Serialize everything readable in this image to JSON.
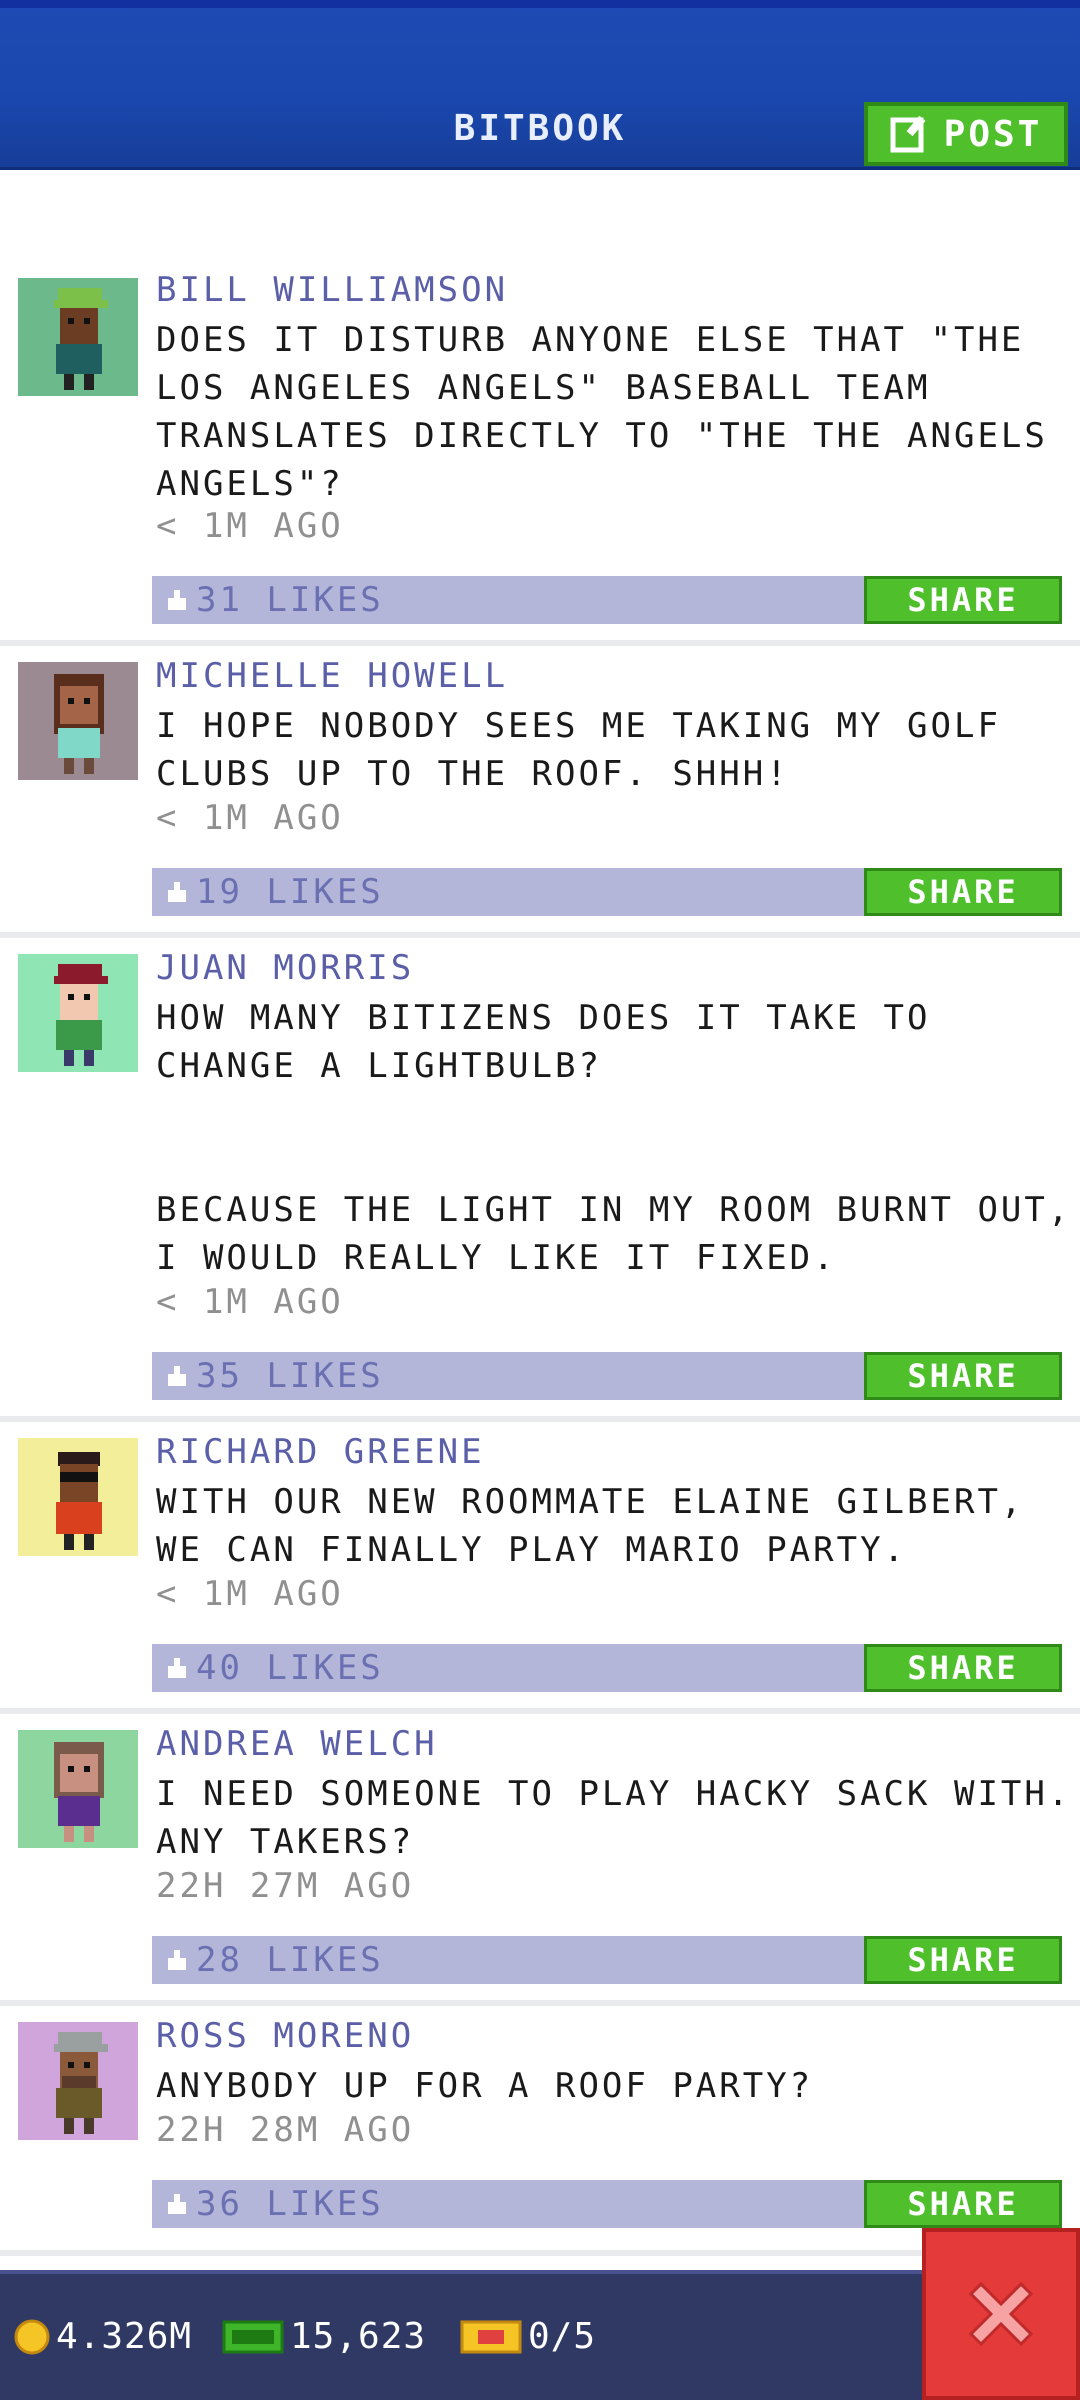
{
  "header": {
    "title": "BITBOOK",
    "post_label": "POST"
  },
  "posts": [
    {
      "name": "BILL WILLIAMSON",
      "text": "DOES IT DISTURB ANYONE ELSE THAT \"THE LOS ANGELES ANGELS\" BASEBALL TEAM TRANSLATES DIRECTLY TO \"THE THE ANGELS ANGELS\"?",
      "time": "< 1M AGO",
      "likes": "31 LIKES",
      "share": "SHARE",
      "avatar_bg": "#6cb98c",
      "shirt": "#1f5f5f",
      "hat": "#7cc04a",
      "skin": "#6b3d22"
    },
    {
      "name": "MICHELLE HOWELL",
      "text": "I HOPE NOBODY SEES ME TAKING MY GOLF CLUBS UP TO THE ROOF. SHHH!",
      "time": "< 1M AGO",
      "likes": "19 LIKES",
      "share": "SHARE",
      "avatar_bg": "#9c8a92",
      "shirt": "#7fd8c8",
      "hat": "#5a2e1c",
      "skin": "#a46448"
    },
    {
      "name": "JUAN MORRIS",
      "text": "HOW MANY BITIZENS DOES IT TAKE TO CHANGE A LIGHTBULB?\n\n\nBECAUSE THE LIGHT IN MY ROOM BURNT OUT, I WOULD REALLY LIKE IT FIXED.",
      "time": "< 1M AGO",
      "likes": "35 LIKES",
      "share": "SHARE",
      "avatar_bg": "#8fe5b3",
      "shirt": "#3a9a4a",
      "hat": "#8a1a2c",
      "skin": "#f2c8b0"
    },
    {
      "name": "RICHARD GREENE",
      "text": "WITH OUR NEW ROOMMATE ELAINE GILBERT, WE CAN FINALLY PLAY MARIO PARTY.",
      "time": "< 1M AGO",
      "likes": "40 LIKES",
      "share": "SHARE",
      "avatar_bg": "#f2ee9a",
      "shirt": "#d8401e",
      "hat": "#2a1a1a",
      "skin": "#7a4526"
    },
    {
      "name": "ANDREA WELCH",
      "text": "I NEED SOMEONE TO PLAY HACKY SACK WITH. ANY TAKERS?",
      "time": "22H 27M AGO",
      "likes": "28 LIKES",
      "share": "SHARE",
      "avatar_bg": "#8ed6a0",
      "shirt": "#5a2e8e",
      "hat": "#7a5a4a",
      "skin": "#c89080"
    },
    {
      "name": "ROSS MORENO",
      "text": "ANYBODY UP FOR A ROOF PARTY?",
      "time": "22H 28M AGO",
      "likes": "36 LIKES",
      "share": "SHARE",
      "avatar_bg": "#cfa5dc",
      "shirt": "#6a5a2a",
      "hat": "#9aa0a0",
      "skin": "#8a5a3a"
    }
  ],
  "footer": {
    "coins": "4.326M",
    "bux": "15,623",
    "tickets": "0/5"
  }
}
